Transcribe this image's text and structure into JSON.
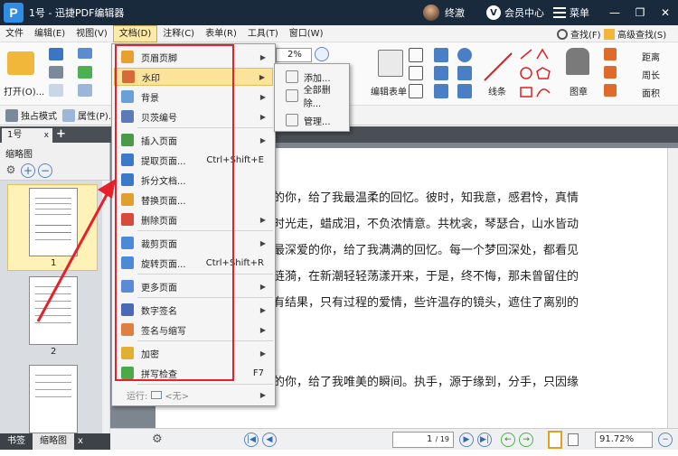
{
  "window": {
    "logo": "P",
    "title": "1号 - 迅捷PDF编辑器",
    "username": "终澈",
    "vip_badge": "V",
    "vip_label": "会员中心",
    "menu_label": "菜单",
    "min": "—",
    "restore": "❐",
    "close": "✕"
  },
  "menubar": [
    "文件",
    "编辑(E)",
    "视图(V)",
    "文档(D)",
    "注释(C)",
    "表单(R)",
    "工具(T)",
    "窗口(W)"
  ],
  "ribbon": {
    "open_label": "打开(O)...",
    "zoom_value": "2%",
    "edit_form": "编辑表单",
    "lines": "线条",
    "stamp": "图章",
    "find": "查找(F)",
    "adv_find": "高级查找(S)",
    "distance": "距离",
    "perimeter": "周长",
    "area": "面积"
  },
  "ribbon2": {
    "exclusive_mode": "独占模式",
    "properties": "属性(P)..."
  },
  "doc_tab": {
    "name": "1号",
    "close": "x",
    "add": "+"
  },
  "sidepanel": {
    "title": "缩略图",
    "pages": [
      "1",
      "2"
    ],
    "tab_bookmarks": "书签",
    "tab_thumbnails": "缩略图",
    "tab_close": "x"
  },
  "document": {
    "lines": [
      "的你，给了我最温柔的回忆。彼时，知我意，感君怜，真情",
      "时光走，蜡成泪，不负浓情意。共枕衾，琴瑟合，山水皆动",
      "最深爱的你，给了我满满的回忆。每一个梦回深处，都看见",
      "涟漪，在新潮轻轻荡漾开来，于是，终不悔，那未曾留住的",
      "有结果，只有过程的爱情，些许温存的镜头，遮住了离别的",
      "的你，给了我唯美的瞬间。执手，源于缘到，分手，只因缘"
    ]
  },
  "statusbar": {
    "page_value": "1",
    "page_total": "/ 19",
    "zoom_value": "91.72%"
  },
  "dropdown": {
    "items": [
      {
        "label": "页眉页脚",
        "shortcut": "",
        "submenu": true,
        "icon": "header-footer-icon"
      },
      {
        "label": "水印",
        "shortcut": "",
        "submenu": true,
        "icon": "watermark-icon"
      },
      {
        "label": "背景",
        "shortcut": "",
        "submenu": true,
        "icon": "background-icon"
      },
      {
        "label": "贝茨编号",
        "shortcut": "",
        "submenu": true,
        "icon": "bates-number-icon"
      },
      {
        "label": "插入页面",
        "shortcut": "",
        "submenu": true,
        "icon": "insert-page-icon"
      },
      {
        "label": "提取页面...",
        "shortcut": "Ctrl+Shift+E",
        "submenu": false,
        "icon": "extract-page-icon"
      },
      {
        "label": "拆分文档...",
        "shortcut": "",
        "submenu": false,
        "icon": "split-doc-icon"
      },
      {
        "label": "替换页面...",
        "shortcut": "",
        "submenu": false,
        "icon": "replace-page-icon"
      },
      {
        "label": "删除页面",
        "shortcut": "",
        "submenu": true,
        "icon": "delete-page-icon"
      },
      {
        "label": "裁剪页面",
        "shortcut": "",
        "submenu": true,
        "icon": "crop-page-icon"
      },
      {
        "label": "旋转页面...",
        "shortcut": "Ctrl+Shift+R",
        "submenu": false,
        "icon": "rotate-page-icon"
      },
      {
        "label": "更多页面",
        "shortcut": "",
        "submenu": true,
        "icon": "more-pages-icon"
      },
      {
        "label": "数字签名",
        "shortcut": "",
        "submenu": true,
        "icon": "digital-signature-icon"
      },
      {
        "label": "签名与缩写",
        "shortcut": "",
        "submenu": true,
        "icon": "sign-initial-icon"
      },
      {
        "label": "加密",
        "shortcut": "",
        "submenu": true,
        "icon": "encrypt-icon"
      },
      {
        "label": "拼写检查",
        "shortcut": "F7",
        "submenu": false,
        "icon": "spell-check-icon"
      }
    ],
    "run_label": "运行:",
    "run_value": "<无>"
  },
  "submenu": {
    "items": [
      "添加...",
      "全部删除...",
      "管理..."
    ]
  },
  "colors": {
    "titlebar": "#1a2a3d",
    "highlight": "#fbe39a",
    "annotation_red": "#e8202a"
  }
}
